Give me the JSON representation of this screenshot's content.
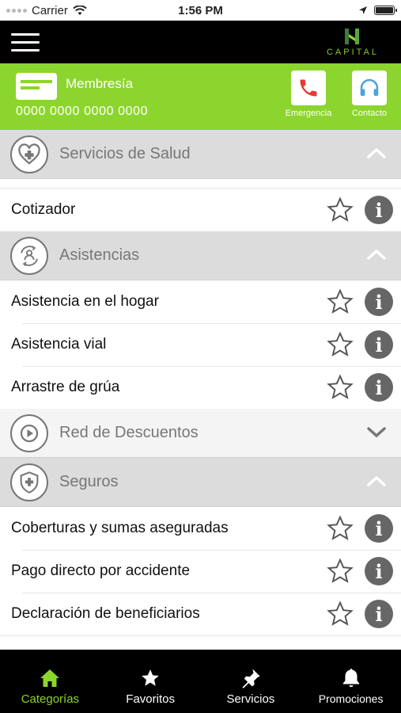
{
  "status_bar": {
    "carrier": "Carrier",
    "time": "1:56 PM"
  },
  "brand": {
    "name": "CAPITAL",
    "accent": "#8cd52e"
  },
  "member": {
    "label": "Membresía",
    "number": "0000 0000 0000 0000"
  },
  "quick_actions": {
    "emergency": "Emergencia",
    "contact": "Contacto"
  },
  "sections": {
    "salud": {
      "title": "Servicios de Salud",
      "items": [
        "Cotizador"
      ]
    },
    "asistencias": {
      "title": "Asistencias",
      "items": [
        "Asistencia en el hogar",
        "Asistencia vial",
        "Arrastre de grúa"
      ]
    },
    "descuentos": {
      "title": "Red de Descuentos"
    },
    "seguros": {
      "title": "Seguros",
      "items": [
        "Coberturas y sumas aseguradas",
        "Pago directo por accidente",
        "Declaración de beneficiarios"
      ]
    }
  },
  "tabs": {
    "categorias": "Categorías",
    "favoritos": "Favoritos",
    "servicios": "Servicios",
    "promociones": "Promociones"
  },
  "icons": [
    "hamburger-menu-icon",
    "credit-card-icon",
    "phone-icon",
    "headset-icon",
    "heart-plus-icon",
    "people-cycle-icon",
    "play-icon",
    "shield-plus-icon",
    "chevron-up-icon",
    "chevron-down-icon",
    "star-outline-icon",
    "info-icon",
    "home-icon",
    "star-icon",
    "pin-icon",
    "bell-icon"
  ]
}
